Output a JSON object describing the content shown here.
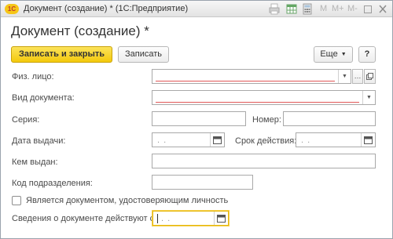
{
  "titlebar": {
    "logo": "1С",
    "title": "Документ (создание) * (1С:Предприятие)",
    "m": "M",
    "mplus": "M+",
    "mminus": "M-"
  },
  "header": {
    "title": "Документ (создание) *"
  },
  "commandbar": {
    "save_close": "Записать и закрыть",
    "save": "Записать",
    "more": "Еще",
    "help": "?"
  },
  "form": {
    "person_label": "Физ. лицо:",
    "person_value": "",
    "doc_type_label": "Вид документа:",
    "doc_type_value": "",
    "series_label": "Серия:",
    "series_value": "",
    "number_label": "Номер:",
    "number_value": "",
    "issue_date_label": "Дата выдачи:",
    "issue_date_value": ". .",
    "valid_until_label": "Срок действия:",
    "valid_until_value": ". .",
    "issued_by_label": "Кем выдан:",
    "issued_by_value": "",
    "dept_code_label": "Код подразделения:",
    "dept_code_value": "",
    "is_identity_label": "Является документом, удостоверяющим личность",
    "valid_from_label": "Сведения о документе действуют с:",
    "valid_from_value": ". ."
  },
  "icons": {
    "print": "printer-icon",
    "table": "table-icon",
    "calendar": "calendar-icon",
    "calc": "calculator-icon",
    "expand": "expand-icon",
    "close": "close-icon",
    "dropdown": "chevron-down-icon",
    "select": "ellipsis-icon",
    "open": "open-link-icon"
  },
  "colors": {
    "accent": "#f3c90d",
    "invalid": "#e15757",
    "focus": "#e5b70d"
  }
}
